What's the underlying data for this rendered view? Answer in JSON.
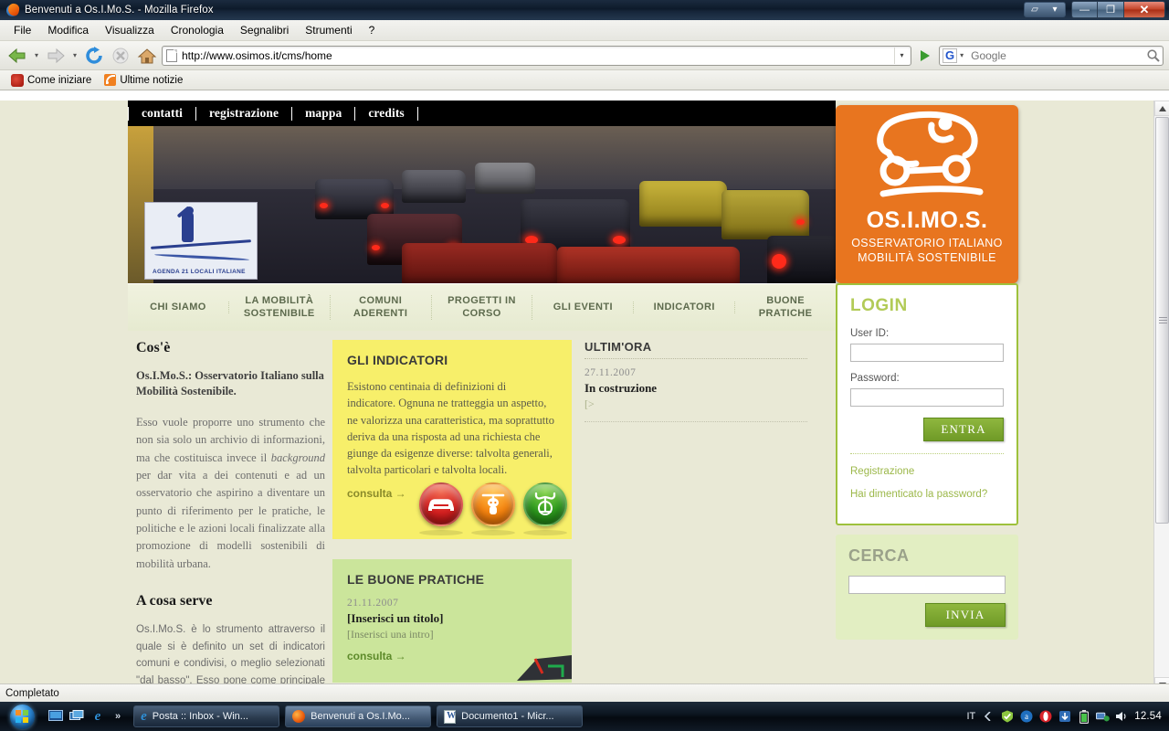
{
  "window": {
    "title": "Benvenuti a Os.I.Mo.S. - Mozilla Firefox",
    "minimize_label": "—",
    "maximize_label": "❐",
    "close_label": "✕"
  },
  "menubar": {
    "items": [
      "File",
      "Modifica",
      "Visualizza",
      "Cronologia",
      "Segnalibri",
      "Strumenti",
      "?"
    ]
  },
  "toolbar": {
    "url_value": "http://www.osimos.it/cms/home",
    "url_placeholder": "",
    "search_placeholder": "Google",
    "search_value": "",
    "search_engine_label": "G",
    "back_label": "Indietro",
    "forward_label": "Avanti",
    "reload_label": "Ricarica",
    "stop_label": "Interrompi",
    "home_label": "Pagina iniziale",
    "go_label": "Vai"
  },
  "bookmarks": {
    "items": [
      {
        "label": "Come iniziare",
        "icon": "mask-icon"
      },
      {
        "label": "Ultime notizie",
        "icon": "rss-icon"
      }
    ]
  },
  "site": {
    "topnav": [
      "contatti",
      "registrazione",
      "mappa",
      "credits"
    ],
    "banner": {
      "alt": "Traffico urbano congestionato",
      "badge_caption": "AGENDA 21 LOCALI ITALIANE"
    },
    "logo": {
      "title": "OS.I.MO.S.",
      "line1": "OSSERVATORIO ITALIANO",
      "line2": "MOBILITÀ SOSTENIBILE",
      "color": "#e8751f"
    },
    "mainnav": [
      "CHI SIAMO",
      "LA MOBILITÀ SOSTENIBILE",
      "COMUNI ADERENTI",
      "PROGETTI IN CORSO",
      "GLI EVENTI",
      "INDICATORI",
      "BUONE PRATICHE"
    ],
    "left": {
      "h1": "Cos'è",
      "lead": "Os.I.Mo.S.: Osservatorio Italiano sulla Mobilità Sostenibile.",
      "body_pre": "Esso vuole proporre uno strumento che non sia solo un archivio di informazioni, ma che costituisca invece il ",
      "body_em": "background",
      "body_post": " per dar vita a dei contenuti e ad un osservatorio che aspirino a diventare un punto di riferimento per le pratiche, le politiche e le azioni locali finalizzate alla promozione di modelli sostenibili di mobilità urbana.",
      "h2": "A cosa serve",
      "body2": "Os.I.Mo.S. è lo strumento attraverso il quale si è definito un set di indicatori comuni e condivisi, o meglio selezionati \"dal basso\". Esso pone come principale obiettivo l'uitilizzo di questi indicatori"
    },
    "indicatori": {
      "title": "GLI INDICATORI",
      "text": "Esistono centinaia di definizioni di indicatore. Ognuna ne tratteggia un aspetto, ne valorizza una caratteristica, ma soprattutto deriva da una risposta ad una richiesta che giunge da esigenze diverse: talvolta generali, talvolta particolari e talvolta locali.",
      "cta": "consulta →",
      "bg": "#f7ef6a",
      "icons": [
        "car-icon",
        "scooter-icon",
        "bicycle-icon"
      ]
    },
    "pratiche": {
      "title": "LE BUONE PRATICHE",
      "date": "21.11.2007",
      "headline": "[Inserisci un titolo]",
      "intro": "[Inserisci una intro]",
      "cta": "consulta →",
      "bg": "#cbe59b"
    },
    "ultimora": {
      "title": "ULTIM'ORA",
      "date": "27.11.2007",
      "headline": "In costruzione",
      "more": "[>"
    },
    "login": {
      "title": "LOGIN",
      "userid_label": "User ID:",
      "userid_value": "",
      "password_label": "Password:",
      "password_value": "",
      "submit_label": "ENTRA",
      "link_registrazione": "Registrazione",
      "link_password": "Hai dimenticato la password?"
    },
    "cerca": {
      "title": "CERCA",
      "query_value": "",
      "submit_label": "INVIA"
    }
  },
  "statusbar": {
    "text": "Completato"
  },
  "taskbar": {
    "start_label": "Start",
    "quicklaunch": [
      "show-desktop-icon",
      "switch-windows-icon",
      "internet-explorer-icon"
    ],
    "overflow_label": "»",
    "tasks": [
      {
        "label": "Posta :: Inbox - Win...",
        "icon": "internet-explorer-icon",
        "active": false
      },
      {
        "label": "Benvenuti a Os.I.Mo...",
        "icon": "firefox-icon",
        "active": true
      },
      {
        "label": "Documento1 - Micr...",
        "icon": "word-icon",
        "active": false
      }
    ],
    "tray": {
      "language": "IT",
      "icons": [
        "chevron-left-icon",
        "security-shield-icon",
        "avg-icon",
        "opera-icon",
        "update-icon",
        "battery-icon",
        "network-icon",
        "volume-icon"
      ],
      "clock": "12.54"
    }
  }
}
